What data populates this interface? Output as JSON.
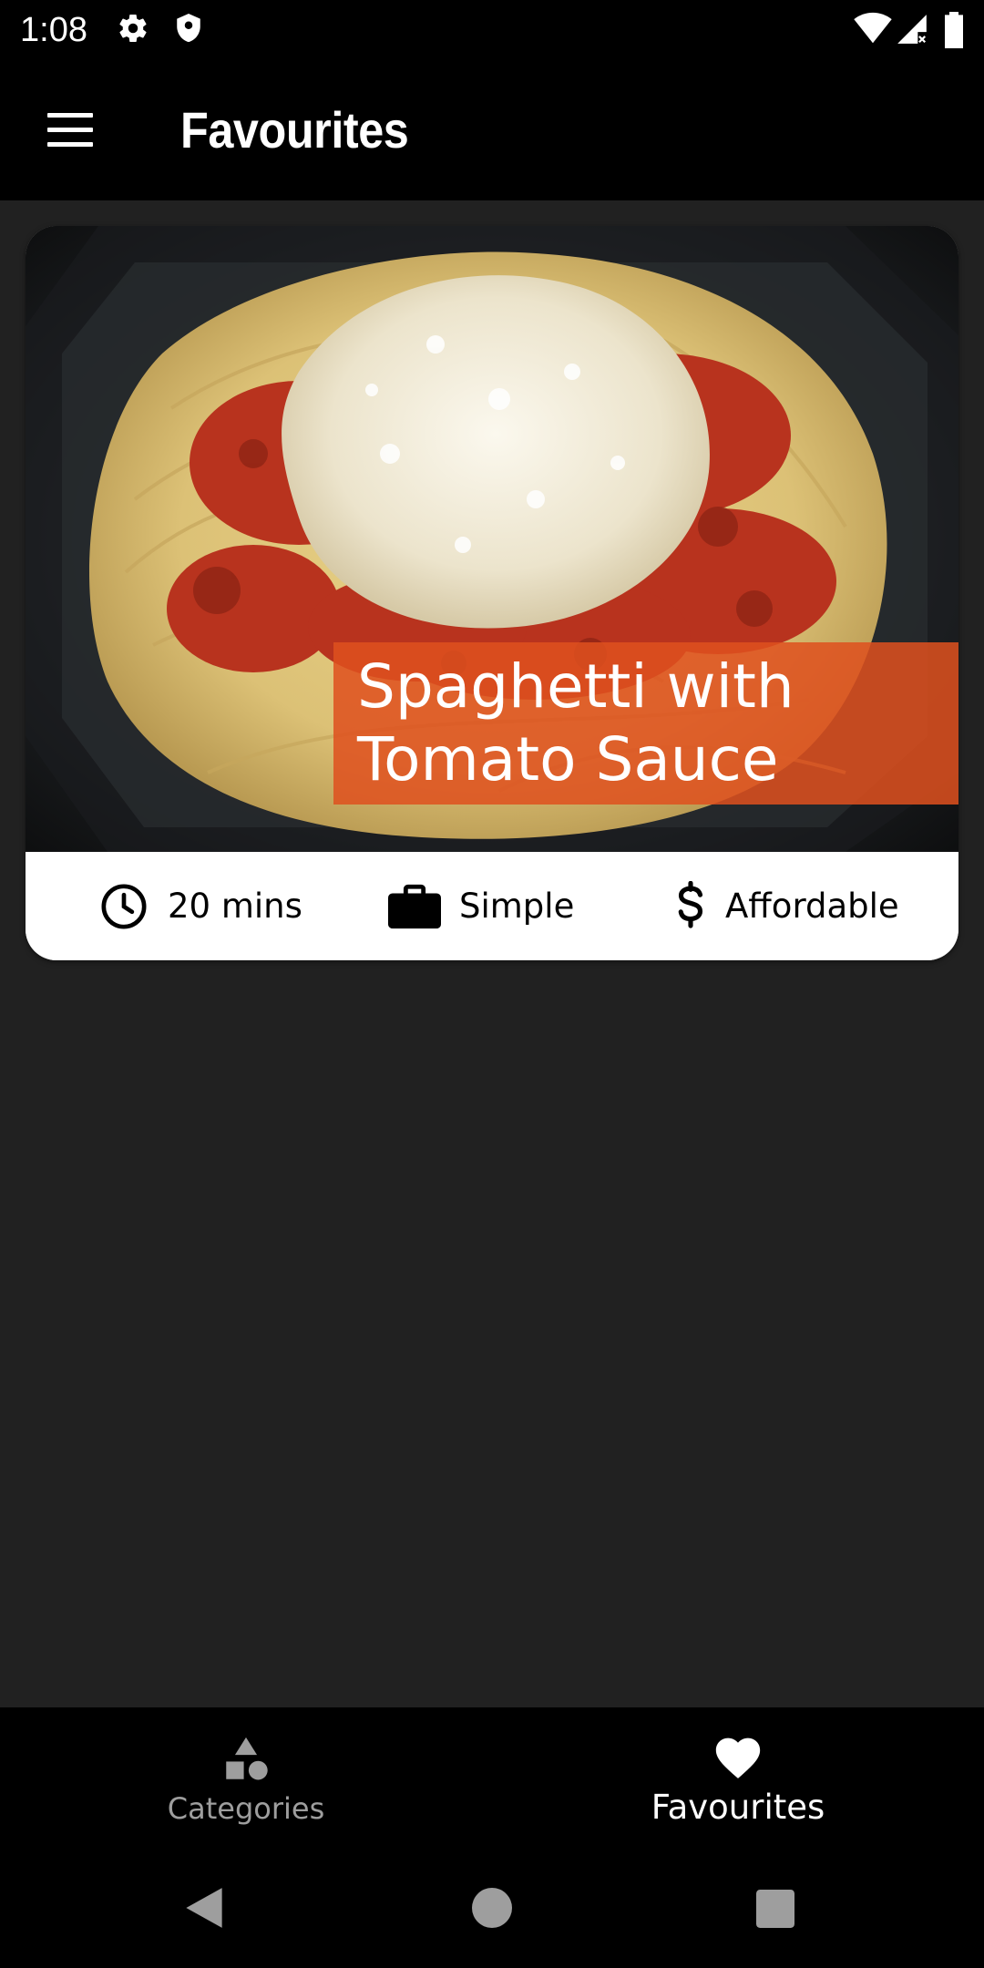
{
  "status_bar": {
    "time": "1:08",
    "icons": [
      "gear-icon",
      "shield-icon",
      "wifi-icon",
      "signal-icon",
      "battery-icon"
    ]
  },
  "app_bar": {
    "title": "Favourites",
    "menu_icon": "hamburger-menu-icon"
  },
  "recipes": [
    {
      "title": "Spaghetti with Tomato Sauce",
      "duration": "20 mins",
      "complexity": "Simple",
      "affordability": "Affordable",
      "image": "spaghetti-with-tomato-sauce-photo"
    }
  ],
  "bottom_nav": {
    "items": [
      {
        "label": "Categories",
        "icon": "category-shapes-icon",
        "selected": false
      },
      {
        "label": "Favourites",
        "icon": "heart-icon",
        "selected": true
      }
    ]
  },
  "system_nav": {
    "buttons": [
      "back-icon",
      "home-icon",
      "recents-icon"
    ]
  },
  "colors": {
    "background": "#212121",
    "app_bar": "#000000",
    "title_overlay": "#de501e",
    "nav_selected": "#ffffff",
    "nav_unselected": "#9e9e9e"
  }
}
